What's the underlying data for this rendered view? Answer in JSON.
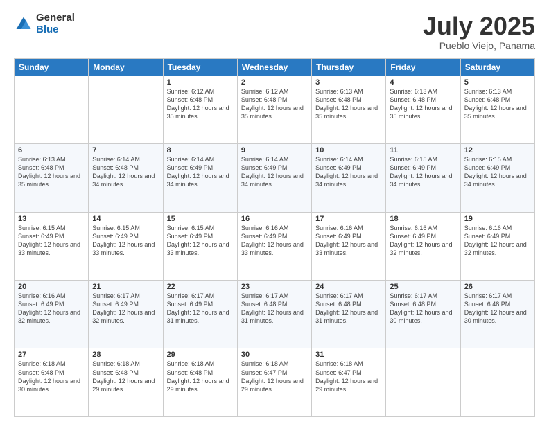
{
  "header": {
    "logo_general": "General",
    "logo_blue": "Blue",
    "title": "July 2025",
    "subtitle": "Pueblo Viejo, Panama"
  },
  "columns": [
    "Sunday",
    "Monday",
    "Tuesday",
    "Wednesday",
    "Thursday",
    "Friday",
    "Saturday"
  ],
  "weeks": [
    [
      {
        "day": "",
        "info": ""
      },
      {
        "day": "",
        "info": ""
      },
      {
        "day": "1",
        "info": "Sunrise: 6:12 AM\nSunset: 6:48 PM\nDaylight: 12 hours and 35 minutes."
      },
      {
        "day": "2",
        "info": "Sunrise: 6:12 AM\nSunset: 6:48 PM\nDaylight: 12 hours and 35 minutes."
      },
      {
        "day": "3",
        "info": "Sunrise: 6:13 AM\nSunset: 6:48 PM\nDaylight: 12 hours and 35 minutes."
      },
      {
        "day": "4",
        "info": "Sunrise: 6:13 AM\nSunset: 6:48 PM\nDaylight: 12 hours and 35 minutes."
      },
      {
        "day": "5",
        "info": "Sunrise: 6:13 AM\nSunset: 6:48 PM\nDaylight: 12 hours and 35 minutes."
      }
    ],
    [
      {
        "day": "6",
        "info": "Sunrise: 6:13 AM\nSunset: 6:48 PM\nDaylight: 12 hours and 35 minutes."
      },
      {
        "day": "7",
        "info": "Sunrise: 6:14 AM\nSunset: 6:48 PM\nDaylight: 12 hours and 34 minutes."
      },
      {
        "day": "8",
        "info": "Sunrise: 6:14 AM\nSunset: 6:49 PM\nDaylight: 12 hours and 34 minutes."
      },
      {
        "day": "9",
        "info": "Sunrise: 6:14 AM\nSunset: 6:49 PM\nDaylight: 12 hours and 34 minutes."
      },
      {
        "day": "10",
        "info": "Sunrise: 6:14 AM\nSunset: 6:49 PM\nDaylight: 12 hours and 34 minutes."
      },
      {
        "day": "11",
        "info": "Sunrise: 6:15 AM\nSunset: 6:49 PM\nDaylight: 12 hours and 34 minutes."
      },
      {
        "day": "12",
        "info": "Sunrise: 6:15 AM\nSunset: 6:49 PM\nDaylight: 12 hours and 34 minutes."
      }
    ],
    [
      {
        "day": "13",
        "info": "Sunrise: 6:15 AM\nSunset: 6:49 PM\nDaylight: 12 hours and 33 minutes."
      },
      {
        "day": "14",
        "info": "Sunrise: 6:15 AM\nSunset: 6:49 PM\nDaylight: 12 hours and 33 minutes."
      },
      {
        "day": "15",
        "info": "Sunrise: 6:15 AM\nSunset: 6:49 PM\nDaylight: 12 hours and 33 minutes."
      },
      {
        "day": "16",
        "info": "Sunrise: 6:16 AM\nSunset: 6:49 PM\nDaylight: 12 hours and 33 minutes."
      },
      {
        "day": "17",
        "info": "Sunrise: 6:16 AM\nSunset: 6:49 PM\nDaylight: 12 hours and 33 minutes."
      },
      {
        "day": "18",
        "info": "Sunrise: 6:16 AM\nSunset: 6:49 PM\nDaylight: 12 hours and 32 minutes."
      },
      {
        "day": "19",
        "info": "Sunrise: 6:16 AM\nSunset: 6:49 PM\nDaylight: 12 hours and 32 minutes."
      }
    ],
    [
      {
        "day": "20",
        "info": "Sunrise: 6:16 AM\nSunset: 6:49 PM\nDaylight: 12 hours and 32 minutes."
      },
      {
        "day": "21",
        "info": "Sunrise: 6:17 AM\nSunset: 6:49 PM\nDaylight: 12 hours and 32 minutes."
      },
      {
        "day": "22",
        "info": "Sunrise: 6:17 AM\nSunset: 6:49 PM\nDaylight: 12 hours and 31 minutes."
      },
      {
        "day": "23",
        "info": "Sunrise: 6:17 AM\nSunset: 6:48 PM\nDaylight: 12 hours and 31 minutes."
      },
      {
        "day": "24",
        "info": "Sunrise: 6:17 AM\nSunset: 6:48 PM\nDaylight: 12 hours and 31 minutes."
      },
      {
        "day": "25",
        "info": "Sunrise: 6:17 AM\nSunset: 6:48 PM\nDaylight: 12 hours and 30 minutes."
      },
      {
        "day": "26",
        "info": "Sunrise: 6:17 AM\nSunset: 6:48 PM\nDaylight: 12 hours and 30 minutes."
      }
    ],
    [
      {
        "day": "27",
        "info": "Sunrise: 6:18 AM\nSunset: 6:48 PM\nDaylight: 12 hours and 30 minutes."
      },
      {
        "day": "28",
        "info": "Sunrise: 6:18 AM\nSunset: 6:48 PM\nDaylight: 12 hours and 29 minutes."
      },
      {
        "day": "29",
        "info": "Sunrise: 6:18 AM\nSunset: 6:48 PM\nDaylight: 12 hours and 29 minutes."
      },
      {
        "day": "30",
        "info": "Sunrise: 6:18 AM\nSunset: 6:47 PM\nDaylight: 12 hours and 29 minutes."
      },
      {
        "day": "31",
        "info": "Sunrise: 6:18 AM\nSunset: 6:47 PM\nDaylight: 12 hours and 29 minutes."
      },
      {
        "day": "",
        "info": ""
      },
      {
        "day": "",
        "info": ""
      }
    ]
  ]
}
